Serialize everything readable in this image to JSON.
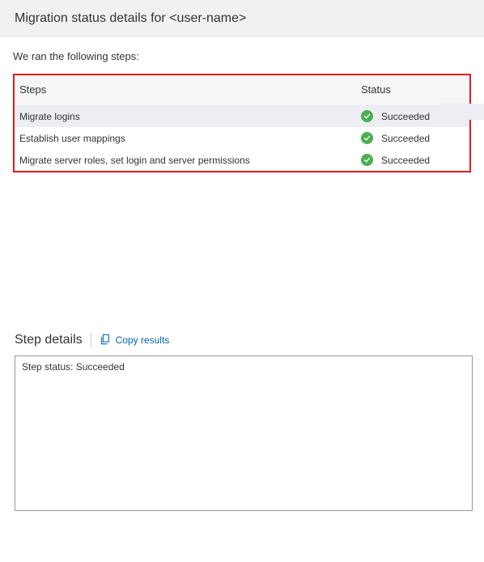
{
  "header": {
    "title": "Migration status details for <user-name>"
  },
  "intro": "We ran the following steps:",
  "table": {
    "col_steps": "Steps",
    "col_status": "Status",
    "rows": [
      {
        "step": "Migrate logins",
        "status": "Succeeded"
      },
      {
        "step": "Establish user mappings",
        "status": "Succeeded"
      },
      {
        "step": "Migrate server roles, set login and server permissions",
        "status": "Succeeded"
      }
    ]
  },
  "details": {
    "title": "Step details",
    "copy_label": "Copy results",
    "body": "Step status: Succeeded"
  }
}
